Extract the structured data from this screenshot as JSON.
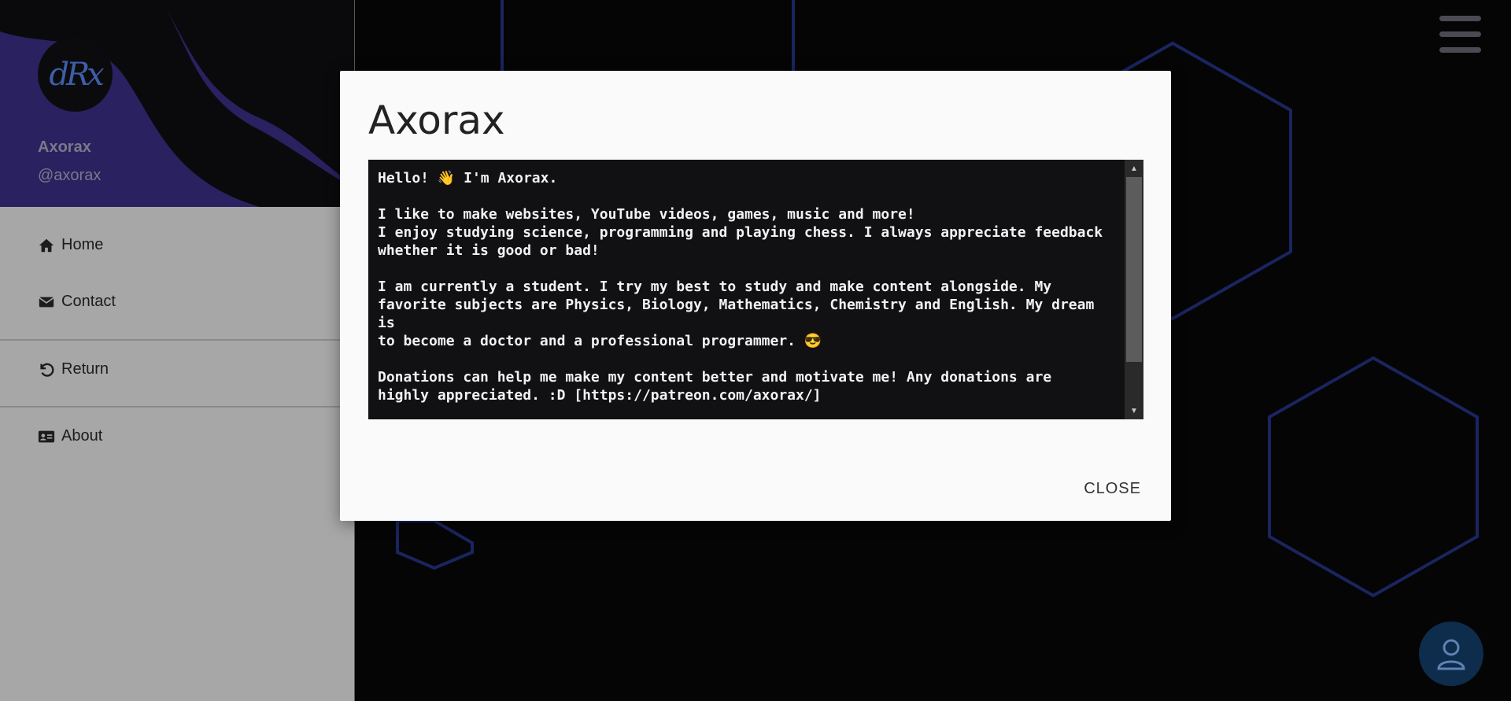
{
  "profile": {
    "avatar_text": "dRx",
    "name": "Axorax",
    "handle": "@axorax"
  },
  "nav": {
    "home": "Home",
    "contact": "Contact",
    "return": "Return",
    "about": "About"
  },
  "modal": {
    "title": "Axorax",
    "body": "Hello! 👋 I'm Axorax.\n\nI like to make websites, YouTube videos, games, music and more!\nI enjoy studying science, programming and playing chess. I always appreciate feedback\nwhether it is good or bad!\n\nI am currently a student. I try my best to study and make content alongside. My\nfavorite subjects are Physics, Biology, Mathematics, Chemistry and English. My dream is\nto become a doctor and a professional programmer. 😎\n\nDonations can help me make my content better and motivate me! Any donations are\nhighly appreciated. :D [https://patreon.com/axorax/]",
    "close_label": "CLOSE"
  },
  "icons": {
    "menu": "hamburger-icon",
    "user": "user-icon",
    "home": "home-icon",
    "contact": "envelope-icon",
    "return": "undo-icon",
    "about": "id-card-icon"
  },
  "colors": {
    "sidebar_header": "#2a2160",
    "hexagon_stroke": "#1c2b66",
    "fab": "#0e2c4b"
  }
}
